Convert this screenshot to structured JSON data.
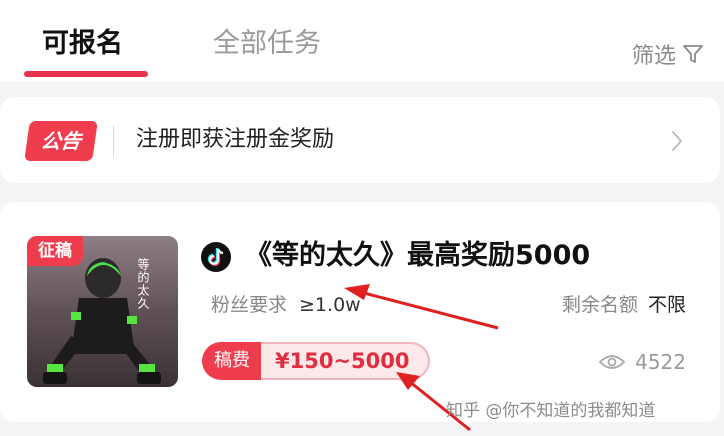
{
  "tabs": [
    {
      "label": "可报名",
      "active": true
    },
    {
      "label": "全部任务",
      "active": false
    }
  ],
  "filter": {
    "label": "筛选",
    "icon": "funnel-icon"
  },
  "notice": {
    "badge": "公告",
    "text": "注册即获注册金奖励",
    "icon": "chevron-right-icon"
  },
  "task": {
    "cover_tag": "征稿",
    "cover_title": "等的太久",
    "platform_icon": "tiktok-icon",
    "title": "《等的太久》最高奖励5000",
    "fans_label": "粉丝要求",
    "fans_value": "≥1.0w",
    "quota_label": "剩余名额",
    "quota_value": "不限",
    "fee_label": "稿费",
    "fee_value": "¥150~5000",
    "views": "4522",
    "views_icon": "eye-icon"
  },
  "watermark": "知乎 @你不知道的我都知道",
  "colors": {
    "accent": "#ef3d4e",
    "annotation_arrow": "#e02020"
  }
}
